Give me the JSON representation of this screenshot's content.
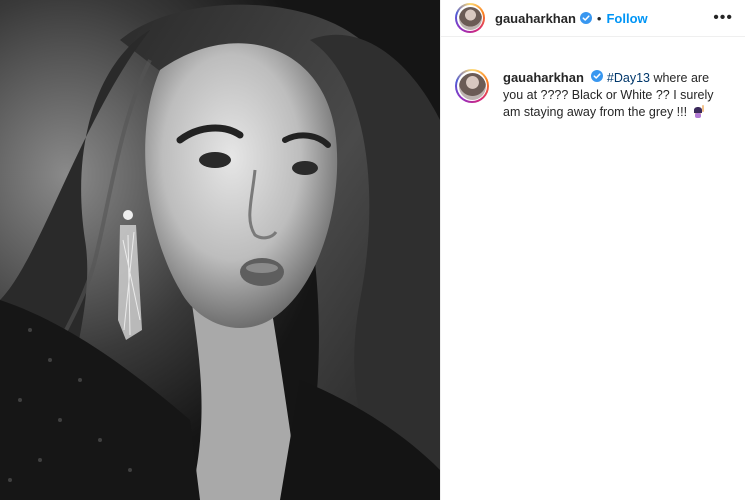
{
  "post": {
    "username": "gauaharkhan",
    "follow_label": "Follow",
    "separator": "•",
    "more_label": "•••",
    "caption": {
      "username": "gauaharkhan",
      "hashtag": "#Day13",
      "text": " where are you at ???? Black or White ?? I surely am staying away from the grey !!! "
    }
  },
  "colors": {
    "follow_blue": "#0095f6",
    "verified_blue": "#3897f0",
    "hashtag_blue": "#00376b"
  },
  "icons": {
    "verified": "verified-badge-icon",
    "more": "more-options-icon",
    "emoji": "woman-raising-hand-emoji"
  }
}
